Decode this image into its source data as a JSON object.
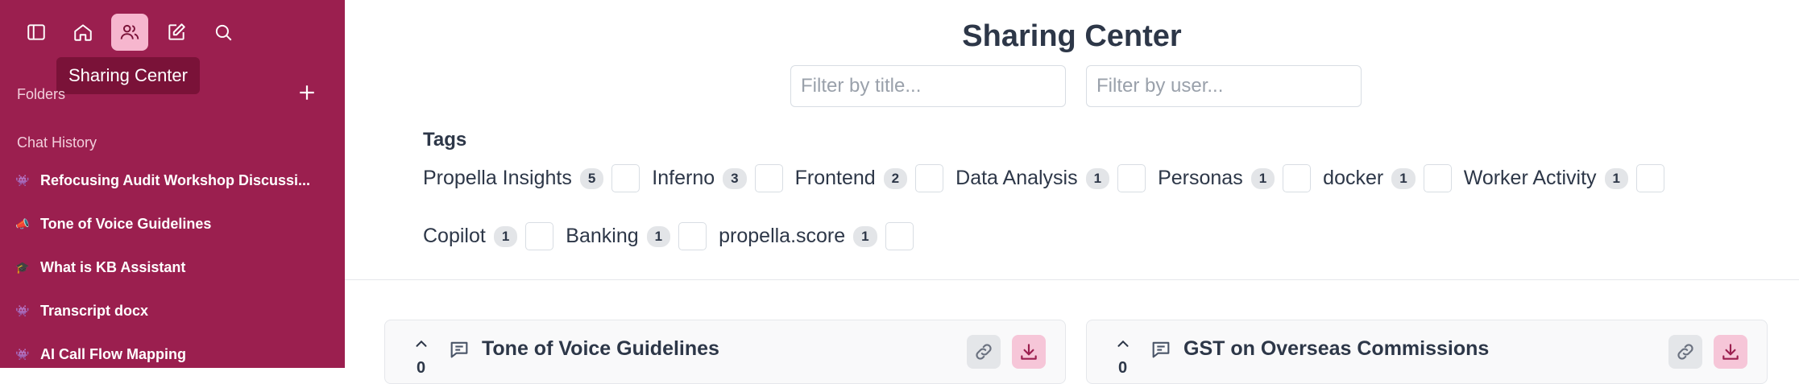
{
  "sidebar": {
    "tooltip": "Sharing Center",
    "folders_label": "Folders",
    "history_label": "Chat History",
    "chats": [
      {
        "emoji": "👾",
        "title": "Refocusing Audit Workshop Discussi..."
      },
      {
        "emoji": "📣",
        "title": "Tone of Voice Guidelines"
      },
      {
        "emoji": "🎓",
        "title": "What is KB Assistant"
      },
      {
        "emoji": "👾",
        "title": "Transcript docx"
      },
      {
        "emoji": "👾",
        "title": "AI Call Flow Mapping"
      }
    ]
  },
  "main": {
    "title": "Sharing Center",
    "filter_title_placeholder": "Filter by title...",
    "filter_user_placeholder": "Filter by user...",
    "tags_heading": "Tags",
    "tags_row1": [
      {
        "name": "Propella Insights",
        "count": "5"
      },
      {
        "name": "Inferno",
        "count": "3"
      },
      {
        "name": "Frontend",
        "count": "2"
      },
      {
        "name": "Data Analysis",
        "count": "1"
      },
      {
        "name": "Personas",
        "count": "1"
      },
      {
        "name": "docker",
        "count": "1"
      },
      {
        "name": "Worker Activity",
        "count": "1"
      }
    ],
    "tags_row2": [
      {
        "name": "Copilot",
        "count": "1"
      },
      {
        "name": "Banking",
        "count": "1"
      },
      {
        "name": "propella.score",
        "count": "1"
      }
    ],
    "cards": [
      {
        "title": "Tone of Voice Guidelines",
        "votes": "0"
      },
      {
        "title": "GST on Overseas Commissions",
        "votes": "0"
      }
    ]
  },
  "colors": {
    "sidebar_bg": "#9b1f4f",
    "active_icon_bg": "#f6b6ce",
    "download_btn_bg": "#f6c6d8",
    "download_icon": "#9b1f4f"
  },
  "icons": [
    "sidebar-toggle-icon",
    "home-icon",
    "users-icon",
    "edit-icon",
    "search-icon",
    "plus-icon",
    "chevron-up-icon",
    "chat-bubble-icon",
    "link-icon",
    "download-icon"
  ]
}
